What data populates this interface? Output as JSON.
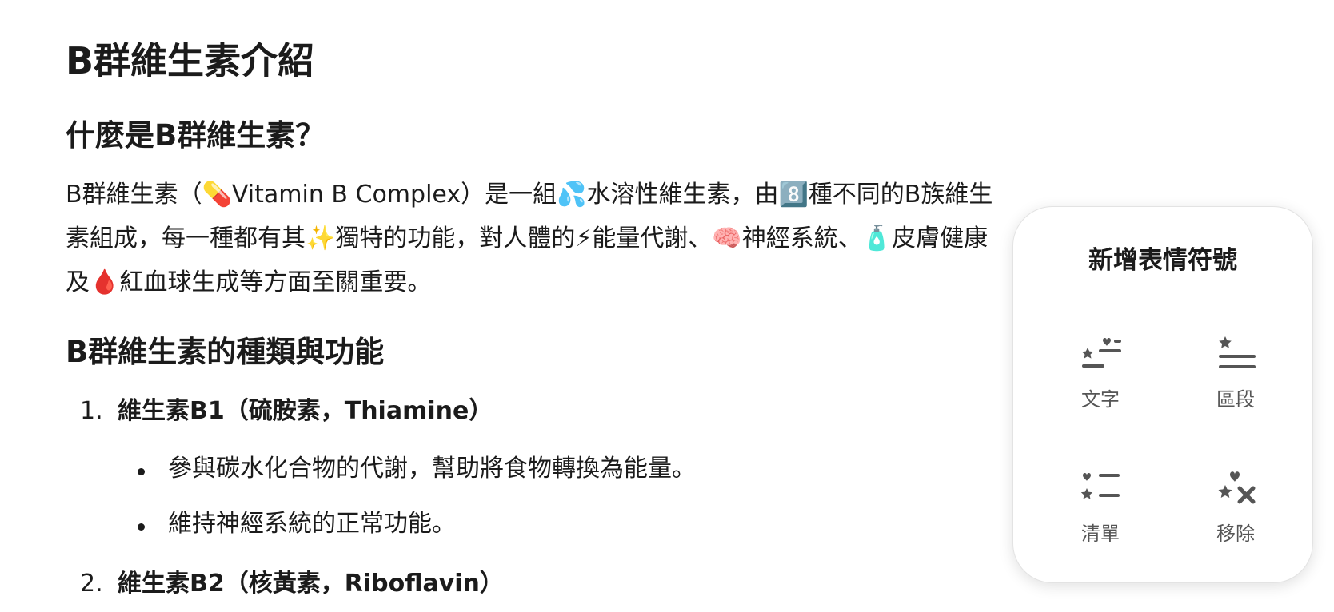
{
  "document": {
    "title": "B群維生素介紹",
    "heading_what": "什麼是B群維生素？",
    "intro_paragraph": "B群維生素（💊Vitamin B Complex）是一組💦水溶性維生素，由8️⃣種不同的B族維生素組成，每一種都有其✨獨特的功能，對人體的⚡能量代謝、🧠神經系統、🧴皮膚健康及🩸紅血球生成等方面至關重要。",
    "heading_types": "B群維生素的種類與功能",
    "items": [
      {
        "number": "1.",
        "title": "維生素B1（硫胺素，Thiamine）",
        "bullets": [
          "參與碳水化合物的代謝，幫助將食物轉換為能量。",
          "維持神經系統的正常功能。"
        ]
      },
      {
        "number": "2.",
        "title": "維生素B2（核黃素，Riboflavin）"
      }
    ]
  },
  "emoji_popover": {
    "title": "新增表情符號",
    "options": [
      {
        "label": "文字",
        "icon": "text-emoji-icon"
      },
      {
        "label": "區段",
        "icon": "section-emoji-icon"
      },
      {
        "label": "清單",
        "icon": "list-emoji-icon"
      },
      {
        "label": "移除",
        "icon": "remove-emoji-icon"
      }
    ],
    "icon_color": "#555555"
  }
}
